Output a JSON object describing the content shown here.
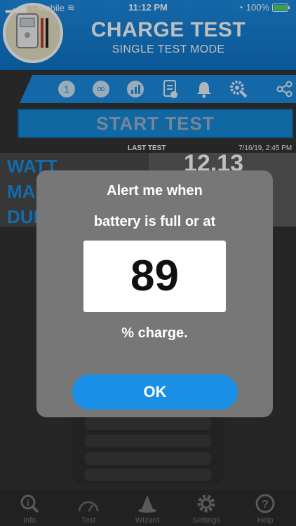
{
  "status_bar": {
    "carrier": "T-Mobile",
    "time": "11:12 PM",
    "battery": "100%"
  },
  "header": {
    "title": "CHARGE TEST",
    "subtitle": "SINGLE TEST MODE"
  },
  "toolbar": {
    "icons": [
      "single-test-icon",
      "continuous-icon",
      "chart-icon",
      "checklist-icon",
      "alarm-bell-icon",
      "gear-wrench-icon",
      "share-icon"
    ],
    "single_label": "1"
  },
  "start_test_label": "START TEST",
  "last_test": {
    "label": "LAST TEST",
    "date": "7/16/19, 2:45 PM",
    "rows": [
      "WATT",
      "MA",
      "DUI"
    ],
    "value": "12.13"
  },
  "alert": {
    "line1": "Alert me when",
    "line2": "battery is full or at",
    "value": "89",
    "line3": "% charge.",
    "ok_label": "OK"
  },
  "tabs": [
    {
      "label": "Info",
      "icon": "info-search-icon"
    },
    {
      "label": "Test",
      "icon": "gauge-icon"
    },
    {
      "label": "Wizard",
      "icon": "wizard-hat-icon"
    },
    {
      "label": "Settings",
      "icon": "gear-icon"
    },
    {
      "label": "Help",
      "icon": "help-icon"
    }
  ],
  "colors": {
    "accent": "#1a8fe6",
    "modal": "#777777",
    "background": "#333333"
  }
}
